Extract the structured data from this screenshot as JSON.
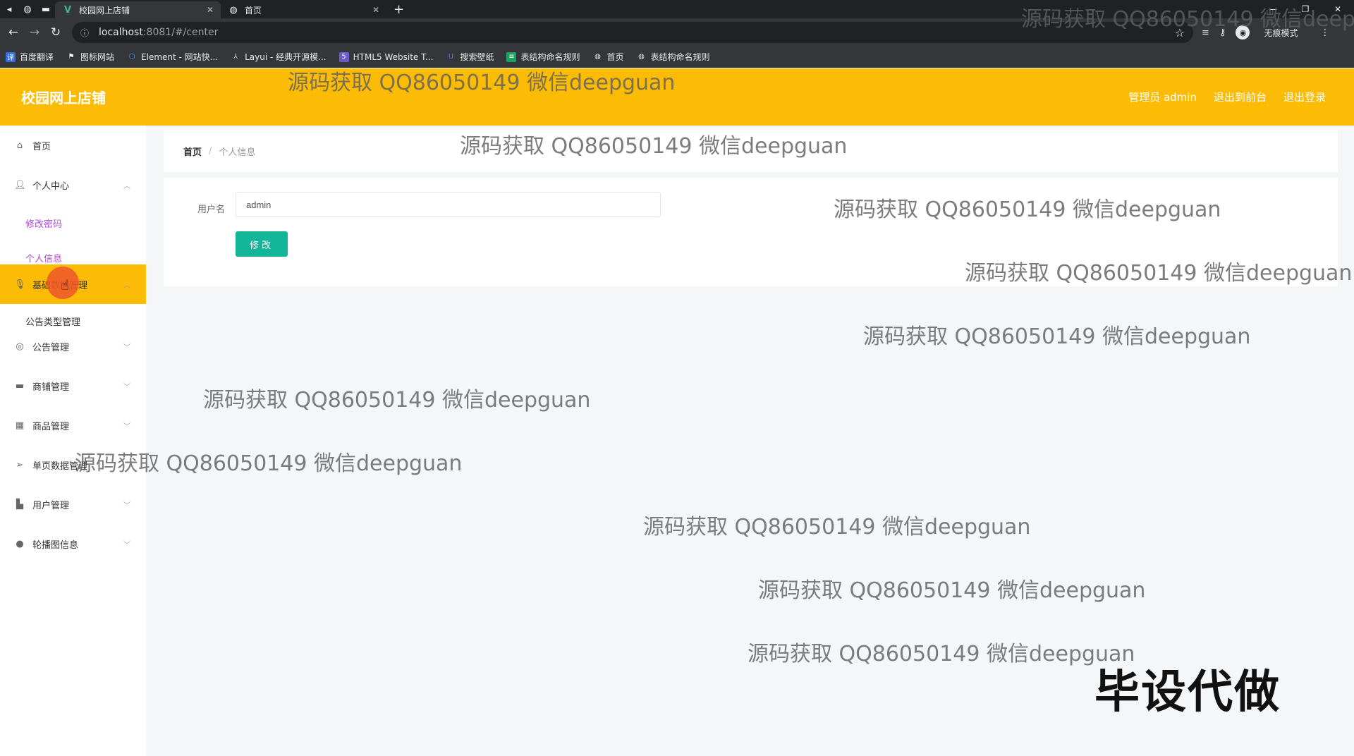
{
  "browser": {
    "tabs": [
      {
        "title": "校园网上店铺",
        "icon": "vue-logo-icon"
      },
      {
        "title": "首页",
        "icon": "globe-icon"
      }
    ],
    "url_host": "localhost",
    "url_path": ":8081/#/center",
    "incognito_label": "无痕模式",
    "bookmarks": [
      {
        "label": "百度翻译",
        "color": "#2f6fe8"
      },
      {
        "label": "图标网站",
        "color": "#444444"
      },
      {
        "label": "Element - 网站快...",
        "color": "#409eff"
      },
      {
        "label": "Layui - 经典开源模...",
        "color": "#666666"
      },
      {
        "label": "HTML5 Website T...",
        "color": "#6a5acd"
      },
      {
        "label": "搜索壁纸",
        "color": "#3b82f6"
      },
      {
        "label": "表结构命名规则",
        "color": "#1ba261"
      },
      {
        "label": "首页",
        "color": "#777777"
      },
      {
        "label": "表结构命名规则",
        "color": "#777777"
      }
    ]
  },
  "app": {
    "title": "校园网上店铺",
    "header_links": [
      "管理员 admin",
      "退出到前台",
      "退出登录"
    ],
    "accent_color": "#fcbc06",
    "button_color": "#12b597"
  },
  "sidebar": {
    "items": [
      {
        "label": "首页",
        "icon": "home-icon"
      },
      {
        "label": "个人中心",
        "icon": "user-icon"
      },
      {
        "label": "基础数据管理",
        "icon": "mic-icon"
      },
      {
        "label": "公告管理",
        "icon": "globe-icon"
      },
      {
        "label": "商铺管理",
        "icon": "chat-icon"
      },
      {
        "label": "商品管理",
        "icon": "grid-icon"
      },
      {
        "label": "单页数据管理",
        "icon": "send-icon"
      },
      {
        "label": "用户管理",
        "icon": "briefcase-icon"
      },
      {
        "label": "轮播图信息",
        "icon": "pin-icon"
      }
    ],
    "personal_sub": [
      "修改密码",
      "个人信息"
    ],
    "basic_sub": [
      "公告类型管理"
    ]
  },
  "breadcrumb": {
    "home": "首页",
    "current": "个人信息"
  },
  "form": {
    "username_label": "用户名",
    "username_value": "admin",
    "submit_label": "修改"
  },
  "overlay": {
    "watermark": "源码获取 QQ86050149 微信deepguan",
    "watermark_cut": "源码获取 QQ86050149 微信deepg",
    "corner_text": "毕设代做"
  }
}
